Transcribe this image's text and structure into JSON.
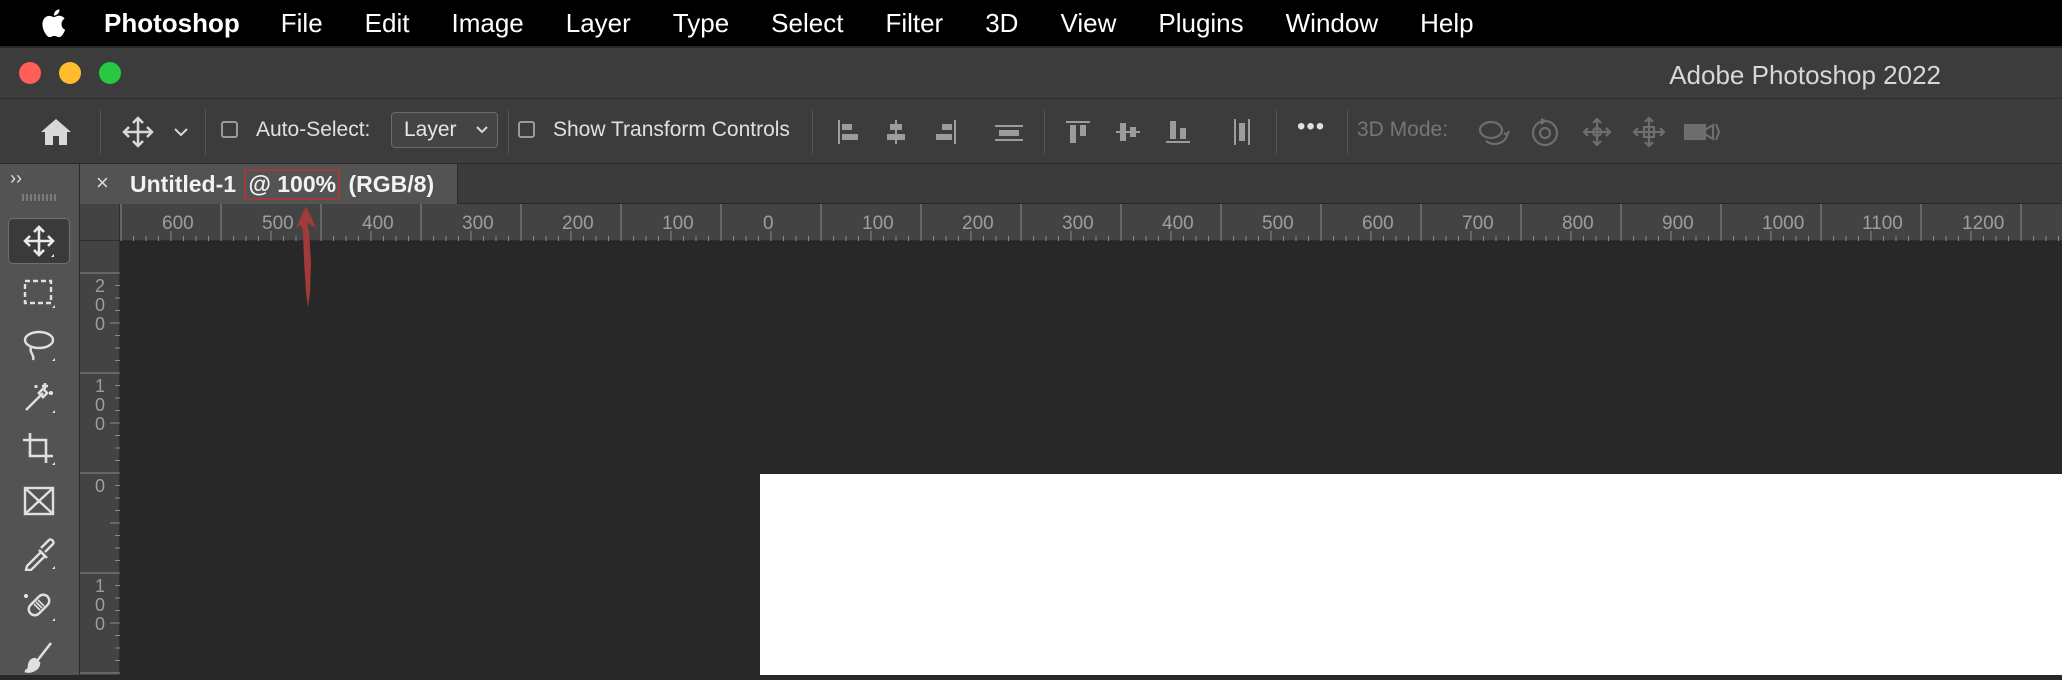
{
  "menubar": {
    "app_name": "Photoshop",
    "items": [
      "File",
      "Edit",
      "Image",
      "Layer",
      "Type",
      "Select",
      "Filter",
      "3D",
      "View",
      "Plugins",
      "Window",
      "Help"
    ]
  },
  "window": {
    "title": "Adobe Photoshop 2022"
  },
  "options_bar": {
    "auto_select_label": "Auto-Select:",
    "auto_select_checked": false,
    "layer_select_value": "Layer",
    "show_transform_label": "Show Transform Controls",
    "show_transform_checked": false,
    "more_label": "•••",
    "threed_mode_label": "3D Mode:"
  },
  "tools_panel": {
    "collapse_glyph": "››",
    "active_tool": "move-tool"
  },
  "document_tab": {
    "close_glyph": "×",
    "name": "Untitled-1",
    "zoom": "@ 100%",
    "mode": "(RGB/8)"
  },
  "rulers": {
    "horizontal": [
      "600",
      "500",
      "400",
      "300",
      "200",
      "100",
      "0",
      "100",
      "200",
      "300",
      "400",
      "500",
      "600",
      "700",
      "800",
      "900",
      "1000",
      "1100",
      "1200"
    ],
    "vertical": [
      "2\n0\n0",
      "1\n0\n0",
      "0",
      "1\n0\n0"
    ]
  },
  "colors": {
    "annotation": "#a33a3a",
    "canvas": "#ffffff",
    "workspace": "#282828"
  }
}
